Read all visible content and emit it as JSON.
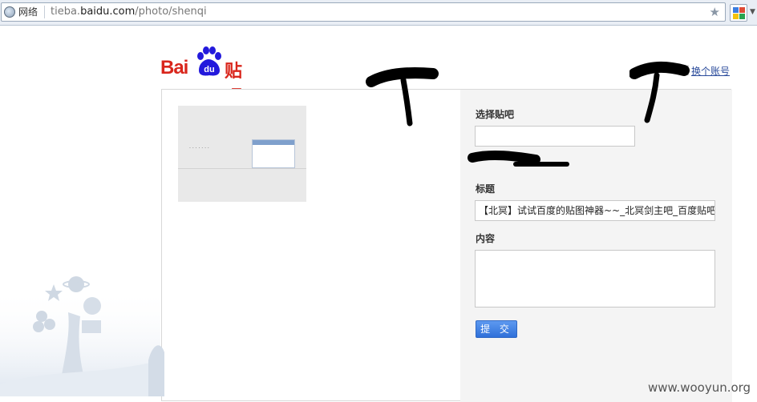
{
  "browser": {
    "network_label": "网络",
    "url_prefix": "tieba.",
    "url_domain": "baidu.com",
    "url_path": "/photo/shenqi"
  },
  "header": {
    "logo_text_bai": "Bai",
    "logo_text_du": "du",
    "logo_text_tieba": "贴吧",
    "switch_account": "换个账号",
    "separator": "|"
  },
  "form": {
    "select_bar_label": "选择贴吧",
    "select_bar_value": "",
    "title_label": "标题",
    "title_value": "【北冥】试试百度的贴图神器~~_北冥剑主吧_百度贴吧",
    "content_label": "内容",
    "content_value": "",
    "submit_label": "提 交"
  },
  "watermark": "www.wooyun.org",
  "colors": {
    "brand_red": "#d9261c",
    "brand_blue": "#2319dc",
    "button_blue": "#2f70d9",
    "link_blue": "#2a4b9b"
  }
}
